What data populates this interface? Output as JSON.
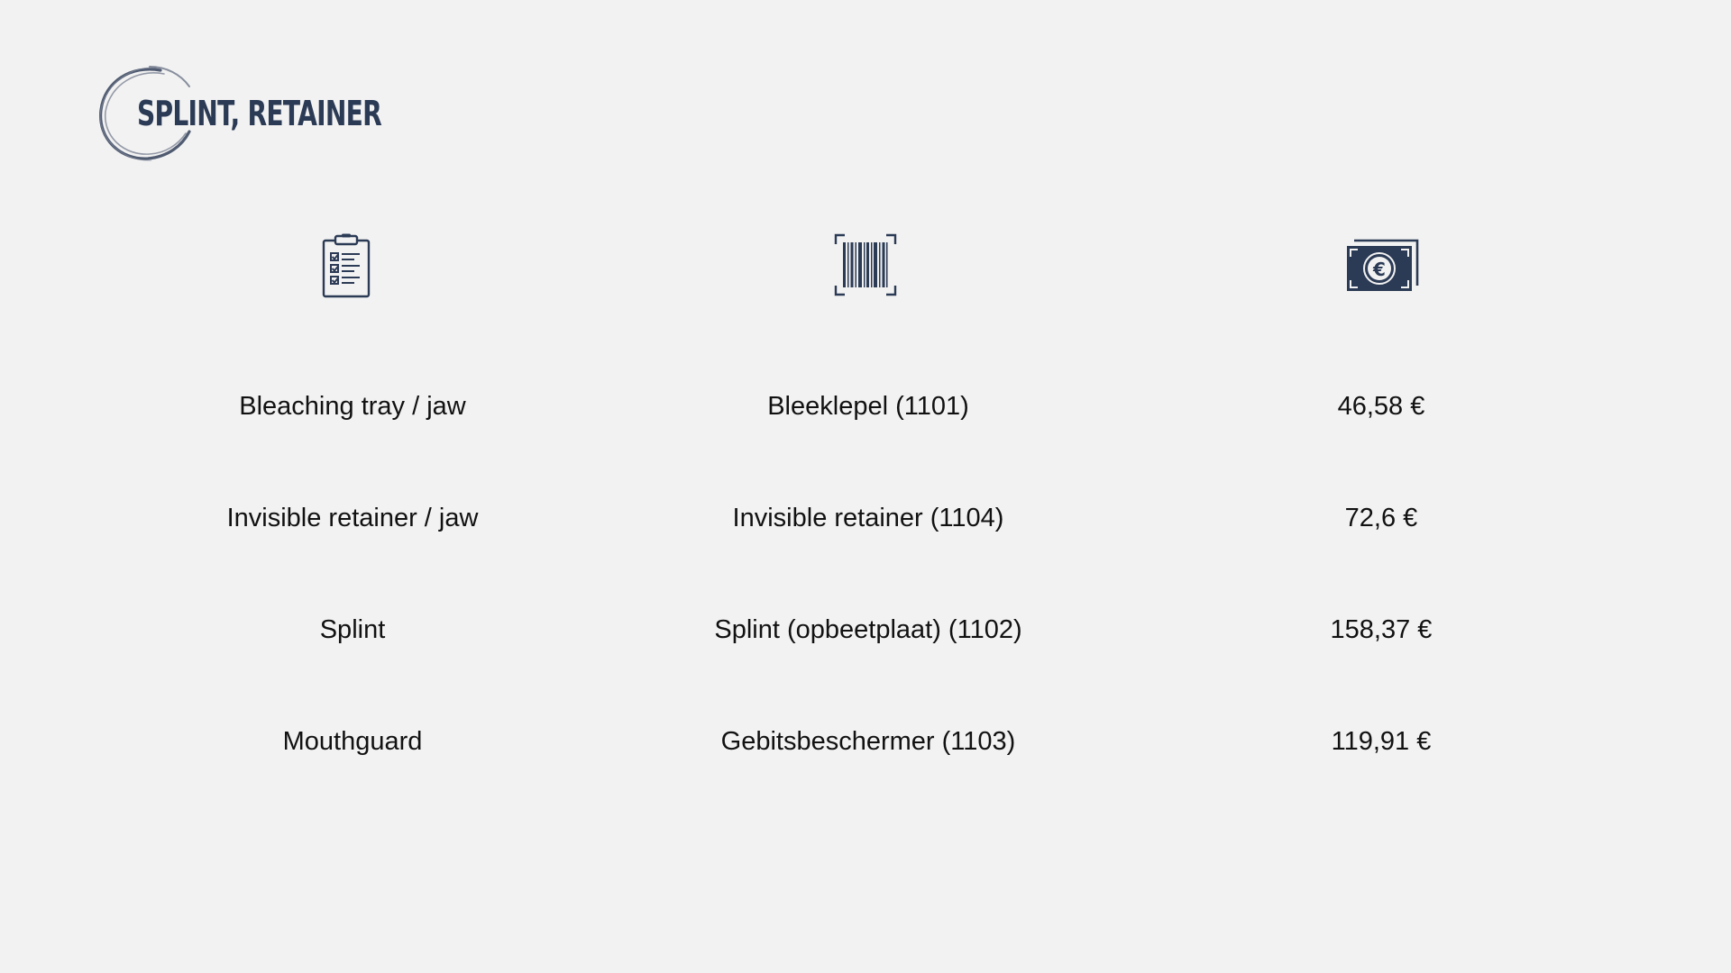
{
  "header": {
    "title": "SPLINT, RETAINER",
    "accent_color": "#2b3a55"
  },
  "columns": [
    {
      "icon": "clipboard-checklist-icon"
    },
    {
      "icon": "barcode-icon"
    },
    {
      "icon": "euro-banknote-icon"
    }
  ],
  "rows": [
    {
      "item": "Bleaching tray / jaw",
      "code": "Bleeklepel (1101)",
      "price": "46,58 €"
    },
    {
      "item": "Invisible retainer / jaw",
      "code": "Invisible retainer (1104)",
      "price": "72,6 €"
    },
    {
      "item": "Splint",
      "code": "Splint (opbeetplaat) (1102)",
      "price": "158,37 €"
    },
    {
      "item": "Mouthguard",
      "code": "Gebitsbeschermer (1103)",
      "price": "119,91 €"
    }
  ]
}
